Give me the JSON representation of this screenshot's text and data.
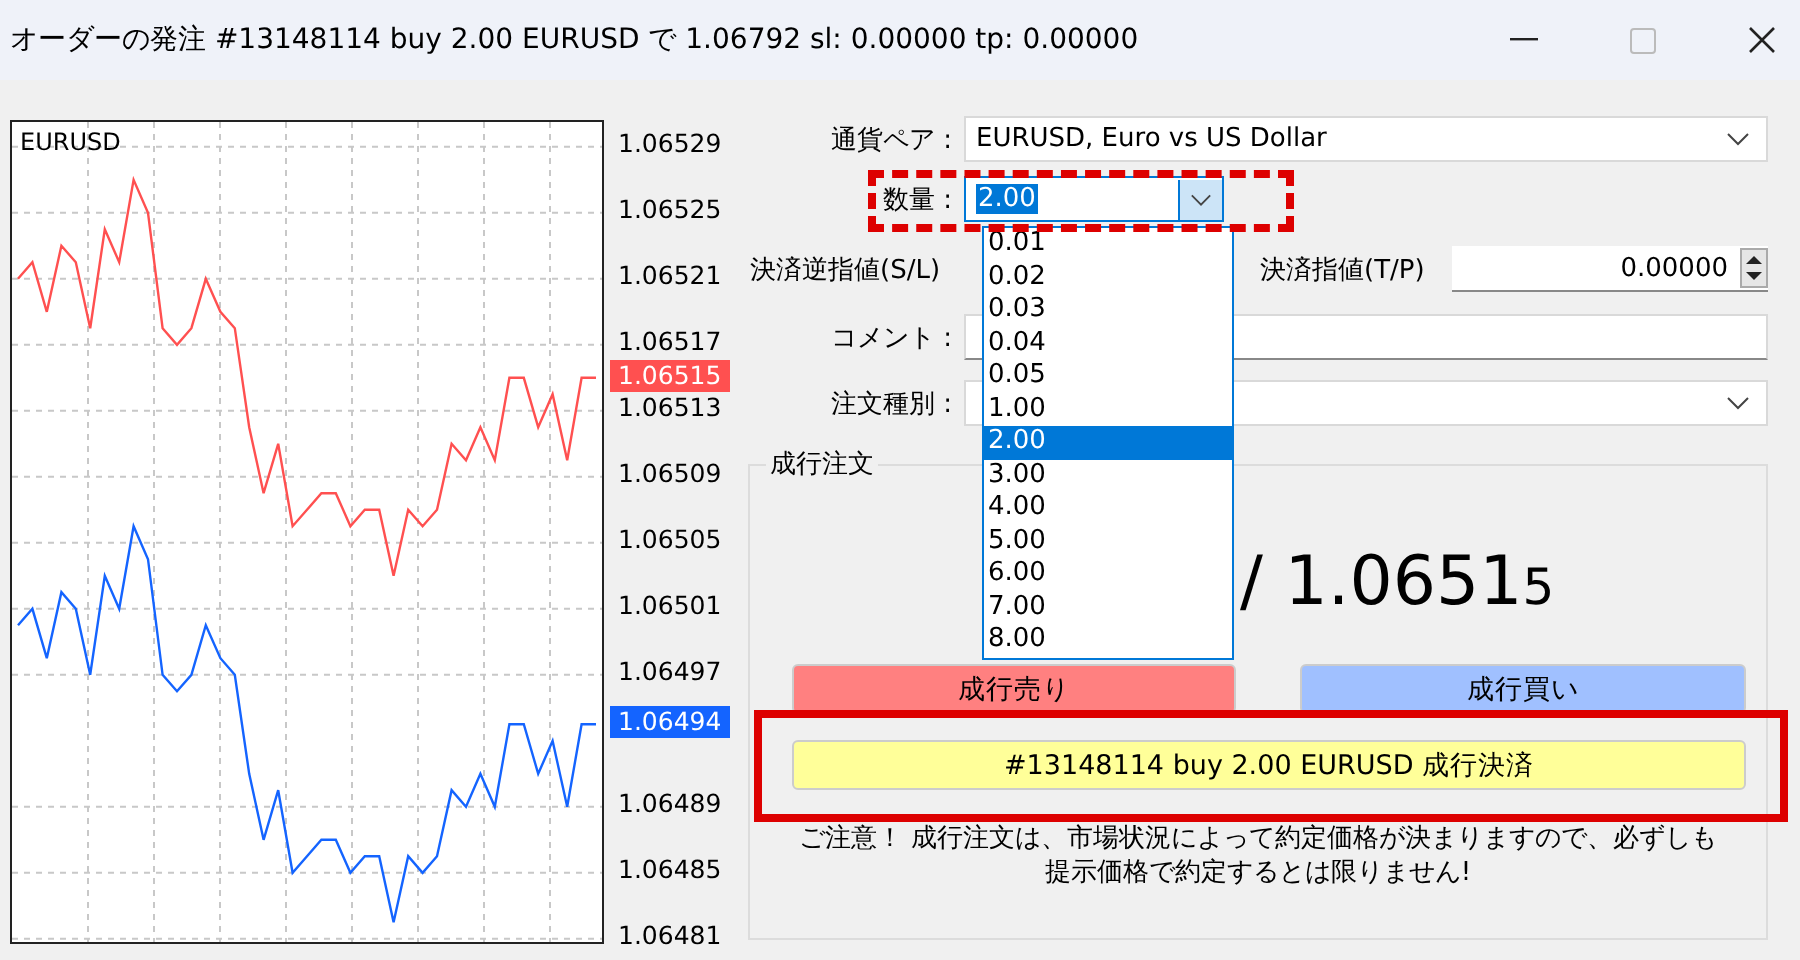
{
  "window": {
    "title": "オーダーの発注 #13148114 buy 2.00 EURUSD で 1.06792 sl: 0.00000 tp: 0.00000"
  },
  "chart": {
    "ask_label": "1.06515",
    "bid_label": "1.06494",
    "chart_data": {
      "type": "line",
      "title": "EURUSD",
      "grid": true,
      "ylim": [
        1.064808,
        1.065305
      ],
      "yticks": [
        1.06529,
        1.06525,
        1.06521,
        1.06517,
        1.06513,
        1.06509,
        1.06505,
        1.06501,
        1.06497,
        1.06489,
        1.06485,
        1.06481
      ],
      "series": [
        {
          "color": "#ff5050",
          "values": [
            1.06521,
            1.06522,
            1.06519,
            1.06523,
            1.06522,
            1.06518,
            1.06524,
            1.06522,
            1.06527,
            1.06525,
            1.06518,
            1.06517,
            1.06518,
            1.06521,
            1.06519,
            1.06518,
            1.06512,
            1.06508,
            1.06511,
            1.06506,
            1.06507,
            1.06508,
            1.06508,
            1.06506,
            1.06507,
            1.06507,
            1.06503,
            1.06507,
            1.06506,
            1.06507,
            1.06511,
            1.0651,
            1.06512,
            1.0651,
            1.06515,
            1.06515,
            1.06512,
            1.06514,
            1.0651,
            1.06515,
            1.06515
          ]
        },
        {
          "color": "#1464ff",
          "values": [
            1.065,
            1.06501,
            1.06498,
            1.06502,
            1.06501,
            1.06497,
            1.06503,
            1.06501,
            1.06506,
            1.06504,
            1.06497,
            1.06496,
            1.06497,
            1.065,
            1.06498,
            1.06497,
            1.06491,
            1.06487,
            1.0649,
            1.06485,
            1.06486,
            1.06487,
            1.06487,
            1.06485,
            1.06486,
            1.06486,
            1.06482,
            1.06486,
            1.06485,
            1.06486,
            1.0649,
            1.06489,
            1.06491,
            1.06489,
            1.06494,
            1.06494,
            1.06491,
            1.06493,
            1.06489,
            1.06494,
            1.06494
          ]
        }
      ]
    }
  },
  "symbol": {
    "label": "通貨ペア :",
    "value": "EURUSD, Euro vs US Dollar"
  },
  "volume": {
    "label": "数量 :",
    "value": "2.00",
    "expanded": true,
    "options": [
      {
        "label": "0.01",
        "selected": false
      },
      {
        "label": "0.02",
        "selected": false
      },
      {
        "label": "0.03",
        "selected": false
      },
      {
        "label": "0.04",
        "selected": false
      },
      {
        "label": "0.05",
        "selected": false
      },
      {
        "label": "1.00",
        "selected": false
      },
      {
        "label": "2.00",
        "selected": true
      },
      {
        "label": "3.00",
        "selected": false
      },
      {
        "label": "4.00",
        "selected": false
      },
      {
        "label": "5.00",
        "selected": false
      },
      {
        "label": "6.00",
        "selected": false
      },
      {
        "label": "7.00",
        "selected": false
      },
      {
        "label": "8.00",
        "selected": false
      }
    ]
  },
  "stop_loss": {
    "label": "決済逆指値(S/L)"
  },
  "take_profit": {
    "label": "決済指値(T/P)",
    "value": "0.00000"
  },
  "comment": {
    "label": "コメント :"
  },
  "order_type": {
    "label": "注文種別 :"
  },
  "market_order": {
    "title": "成行注文",
    "price_main": "/ 1.0651",
    "price_last": "5",
    "sell_button": "成行売り",
    "buy_button": "成行買い",
    "close_button": "#13148114 buy 2.00 EURUSD 成行決済",
    "notice_lines": [
      "ご注意！ 成行注文は、市場状況によって約定価格が決まりますので、必ずしも",
      "提示価格で約定するとは限りません!"
    ]
  },
  "highlights": [
    {
      "kind": "dashed"
    },
    {
      "kind": "solid"
    }
  ]
}
